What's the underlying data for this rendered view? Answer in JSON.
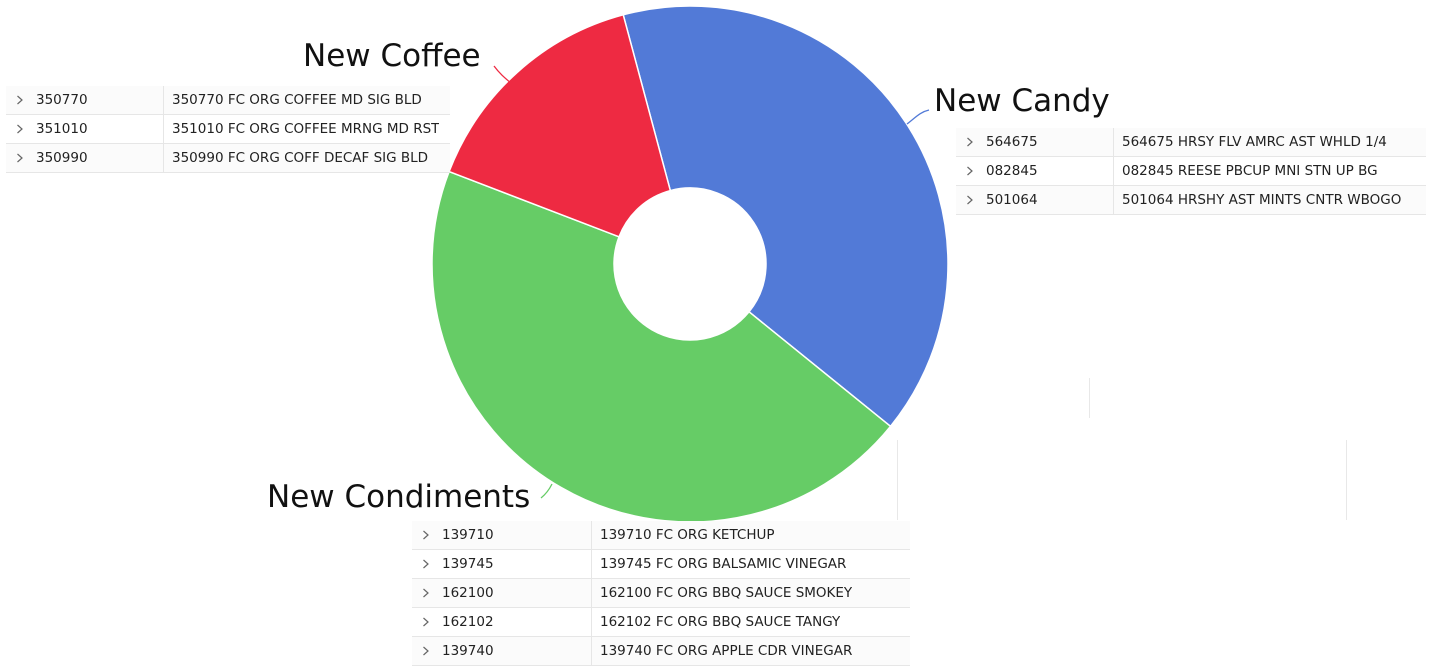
{
  "chart_data": {
    "type": "pie",
    "hole": "donut",
    "slices": [
      {
        "label": "New Candy",
        "value": 40,
        "color": "#527ad7"
      },
      {
        "label": "New Condiments",
        "value": 45,
        "color": "#66cc66"
      },
      {
        "label": "New Coffee",
        "value": 15,
        "color": "#ee2a42"
      }
    ],
    "legend": "none",
    "labels_placement": "outside with leader lines"
  },
  "tables": {
    "coffee": {
      "rows": [
        {
          "code": "350770",
          "desc": "350770 FC ORG COFFEE MD SIG BLD"
        },
        {
          "code": "351010",
          "desc": "351010 FC ORG COFFEE MRNG MD RST"
        },
        {
          "code": "350990",
          "desc": "350990 FC ORG COFF DECAF SIG BLD"
        }
      ]
    },
    "candy": {
      "rows": [
        {
          "code": "564675",
          "desc": "564675 HRSY FLV AMRC AST WHLD 1/4"
        },
        {
          "code": "082845",
          "desc": "082845 REESE PBCUP MNI STN UP BG"
        },
        {
          "code": "501064",
          "desc": "501064 HRSHY AST MINTS CNTR WBOGO"
        }
      ]
    },
    "condiments": {
      "rows": [
        {
          "code": "139710",
          "desc": "139710 FC ORG KETCHUP"
        },
        {
          "code": "139745",
          "desc": "139745 FC ORG BALSAMIC VINEGAR"
        },
        {
          "code": "162100",
          "desc": "162100 FC ORG BBQ SAUCE SMOKEY"
        },
        {
          "code": "162102",
          "desc": "162102 FC ORG BBQ SAUCE TANGY"
        },
        {
          "code": "139740",
          "desc": "139740 FC ORG APPLE CDR VINEGAR"
        }
      ]
    }
  }
}
